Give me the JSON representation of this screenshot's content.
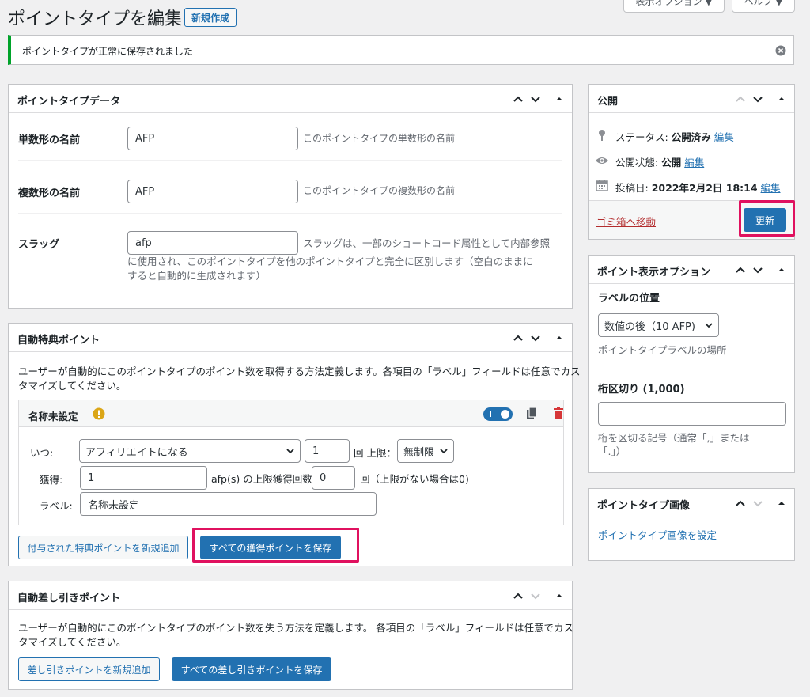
{
  "page": {
    "title": "ポイントタイプを編集",
    "new_button": "新規作成",
    "screen_options": "表示オプション ▼",
    "help": "ヘルプ ▼"
  },
  "notice": {
    "message": "ポイントタイプが正常に保存されました"
  },
  "point_type_data": {
    "title": "ポイントタイプデータ",
    "singular_label": "単数形の名前",
    "singular_value": "AFP",
    "singular_desc": "このポイントタイプの単数形の名前",
    "plural_label": "複数形の名前",
    "plural_value": "AFP",
    "plural_desc": "このポイントタイプの複数形の名前",
    "slug_label": "スラッグ",
    "slug_value": "afp",
    "slug_desc_1": "スラッグは、一部のショートコード属性として内部参照",
    "slug_desc_2": "に使用され、このポイントタイプを他のポイントタイプと完全に区別します（空白のままに",
    "slug_desc_3": "すると自動的に生成されます）"
  },
  "auto_award": {
    "title": "自動特典ポイント",
    "desc_1": "ユーザーが自動的にこのポイントタイプのポイント数を取得する方法定義します。各項目の「ラベル」フィールドは任意でカス",
    "desc_2": "タマイズしてください。",
    "item": {
      "name": "名称未設定",
      "when_label": "いつ:",
      "when_value": "アフィリエイトになる",
      "times_value": "1",
      "times_suffix": "回 上限：",
      "limit_value": "無制限",
      "earn_label": "獲得:",
      "earn_value": "1",
      "earn_suffix": "afp(s) の上限獲得回数",
      "max_value": "0",
      "max_suffix": "回（上限がない場合は0)",
      "label_label": "ラベル:",
      "label_value": "名称未設定"
    },
    "add_button": "付与された特典ポイントを新規追加",
    "save_button": "すべての獲得ポイントを保存"
  },
  "auto_deduct": {
    "title": "自動差し引きポイント",
    "desc_1": "ユーザーが自動的にこのポイントタイプのポイント数を失う方法を定義します。 各項目の「ラベル」フィールドは任意でカス",
    "desc_2": "タマイズしてください。",
    "add_button": "差し引きポイントを新規追加",
    "save_button": "すべての差し引きポイントを保存"
  },
  "publish": {
    "title": "公開",
    "status_label": "ステータス:",
    "status_value": "公開済み",
    "visibility_label": "公開状態:",
    "visibility_value": "公開",
    "date_label": "投稿日:",
    "date_value": "2022年2月2日 18:14",
    "edit": "編集",
    "trash": "ゴミ箱へ移動",
    "update": "更新"
  },
  "display_options": {
    "title": "ポイント表示オプション",
    "label_position_title": "ラベルの位置",
    "label_position_value": "数値の後（10 AFP)",
    "label_position_desc": "ポイントタイプラベルの場所",
    "separator_title": "桁区切り (1,000)",
    "separator_value": "",
    "separator_desc_1": "桁を区切る記号（通常「,」または",
    "separator_desc_2": "「.」）"
  },
  "image_box": {
    "title": "ポイントタイプ画像",
    "set_link": "ポイントタイプ画像を設定"
  },
  "colors": {
    "primary": "#2271b1",
    "success": "#00a32a",
    "danger": "#d63638",
    "warning": "#dba617",
    "highlight": "#e0115f"
  }
}
